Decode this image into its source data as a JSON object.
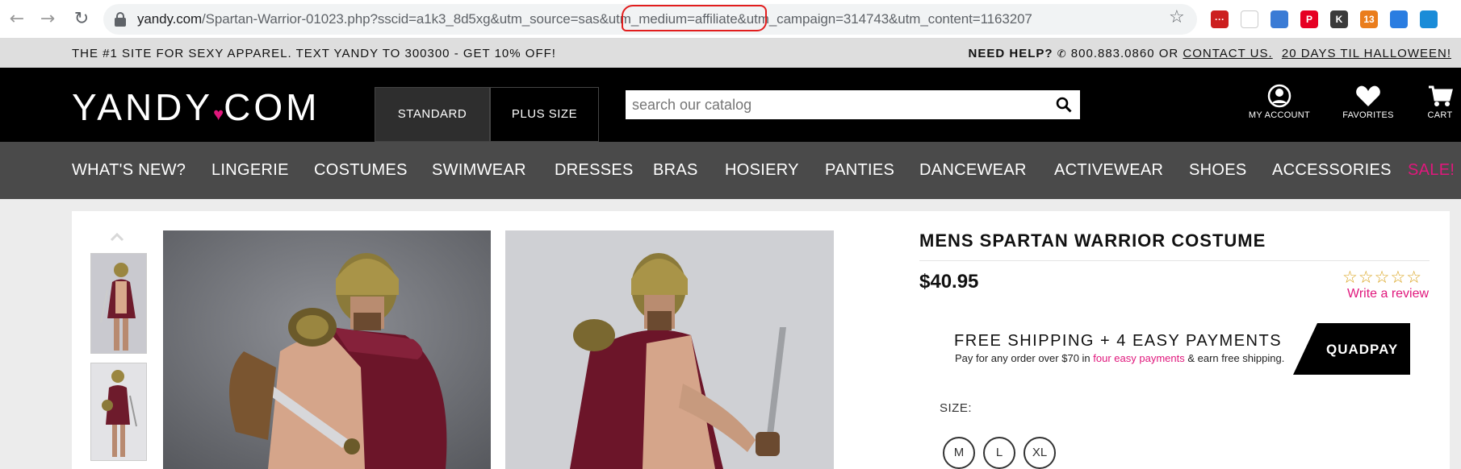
{
  "browser": {
    "url_host": "yandy.com",
    "url_path": "/Spartan-Warrior-01023.php?sscid=a1k3_8d5xg&utm_source=sas&utm_medium=affiliate&utm_campaign=314743&utm_content=1163207",
    "extensions": [
      {
        "name": "lastpass-icon",
        "color": "#cc1f1f",
        "label": "···"
      },
      {
        "name": "grasshopper-icon",
        "color": "#ffffff",
        "label": ""
      },
      {
        "name": "reader-icon",
        "color": "#3a7bd5",
        "label": ""
      },
      {
        "name": "pinterest-icon",
        "color": "#e60023",
        "label": "P"
      },
      {
        "name": "k-icon",
        "color": "#3a3a3a",
        "label": "K"
      },
      {
        "name": "honey-icon",
        "color": "#ea7d1c",
        "label": "13"
      },
      {
        "name": "flame-icon",
        "color": "#2a7de1",
        "label": ""
      },
      {
        "name": "bird-icon",
        "color": "#1a8cd8",
        "label": ""
      }
    ]
  },
  "promo": {
    "left": "THE #1 SITE FOR SEXY APPAREL. TEXT YANDY TO 300300 - GET 10% OFF!",
    "need_help": "NEED HELP?",
    "phone": "800.883.0860 OR",
    "contact": "CONTACT US.",
    "halloween": "20 DAYS TIL HALLOWEEN!"
  },
  "header": {
    "logo_left": "YANDY",
    "logo_right": "COM",
    "size_tabs": [
      "STANDARD",
      "PLUS SIZE"
    ],
    "search_placeholder": "search our catalog",
    "my_account": "MY ACCOUNT",
    "favorites": "FAVORITES",
    "cart": "CART"
  },
  "categories": [
    "WHAT'S NEW?",
    "LINGERIE",
    "COSTUMES",
    "SWIMWEAR",
    "DRESSES",
    "BRAS",
    "HOSIERY",
    "PANTIES",
    "DANCEWEAR",
    "ACTIVEWEAR",
    "SHOES",
    "ACCESSORIES",
    "SALE!"
  ],
  "product": {
    "title": "MENS SPARTAN WARRIOR COSTUME",
    "price": "$40.95",
    "stars": "☆☆☆☆☆",
    "write_review": "Write a review",
    "shipping_title": "FREE SHIPPING + 4 EASY PAYMENTS",
    "shipping_pre": "Pay for any order over $70 in",
    "shipping_link": "four easy payments",
    "shipping_post": "& earn free shipping.",
    "quadpay": "QUADPAY",
    "size_label": "SIZE:",
    "sizes": [
      "M",
      "L",
      "XL"
    ]
  },
  "colors": {
    "accent": "#e0177c",
    "nav_bg": "#4a4a4a",
    "header_bg": "#000000"
  }
}
